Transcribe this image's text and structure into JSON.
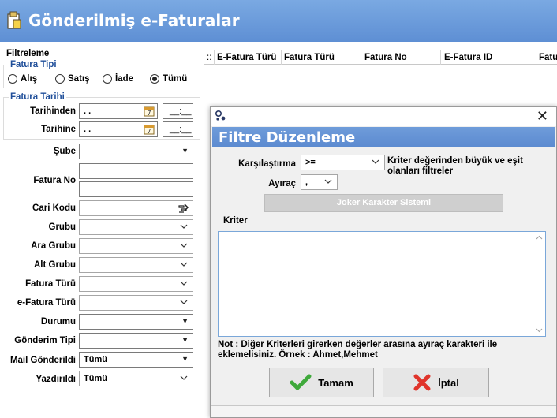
{
  "window": {
    "title": "Gönderilmiş e-Faturalar",
    "icon": "document-icon"
  },
  "filter": {
    "section_label": "Filtreleme",
    "fatura_tipi": {
      "label": "Fatura Tipi",
      "options": [
        {
          "label": "Alış",
          "selected": false
        },
        {
          "label": "Satış",
          "selected": false
        },
        {
          "label": "İade",
          "selected": false
        },
        {
          "label": "Tümü",
          "selected": true
        }
      ]
    },
    "fatura_tarihi": {
      "label": "Fatura Tarihi",
      "from_label": "Tarihinden",
      "to_label": "Tarihine",
      "date_value": ". .",
      "time_value": "__:__",
      "calendar_glyph": "7"
    },
    "fields": [
      {
        "label": "Şube",
        "value": "",
        "control": "combo"
      },
      {
        "label": "Fatura No",
        "value": "",
        "control": "double-text"
      },
      {
        "label": "Cari Kodu",
        "value": "",
        "control": "lookup"
      },
      {
        "label": "Grubu",
        "value": "",
        "control": "dropdown"
      },
      {
        "label": "Ara Grubu",
        "value": "",
        "control": "dropdown"
      },
      {
        "label": "Alt Grubu",
        "value": "",
        "control": "dropdown"
      },
      {
        "label": "Fatura Türü",
        "value": "",
        "control": "dropdown"
      },
      {
        "label": "e-Fatura Türü",
        "value": "",
        "control": "dropdown"
      },
      {
        "label": "Durumu",
        "value": "",
        "control": "combo"
      },
      {
        "label": "Gönderim Tipi",
        "value": "",
        "control": "combo"
      },
      {
        "label": "Mail Gönderildi",
        "value": "Tümü",
        "control": "combo"
      },
      {
        "label": "Yazdırıldı",
        "value": "Tümü",
        "control": "dropdown"
      }
    ]
  },
  "grid": {
    "handle": "::",
    "columns": [
      "E-Fatura Türü",
      "Fatura Türü",
      "Fatura No",
      "E-Fatura ID",
      "Fatu"
    ]
  },
  "dialog": {
    "title": "Filtre Düzenleme",
    "close_glyph": "✕",
    "comparison_label": "Karşılaştırma",
    "comparison_value": ">=",
    "comparison_hint": "Kriter değerinden büyük ve eşit olanları filtreler",
    "separator_label": "Ayıraç",
    "separator_value": ",",
    "joker_button": "Joker Karakter Sistemi",
    "criteria_label": "Kriter",
    "criteria_value": "",
    "note": "Not : Diğer Kriterleri girerken değerler arasına ayıraç karakteri ile eklemelisiniz. Örnek : Ahmet,Mehmet",
    "ok_button": "Tamam",
    "cancel_button": "İptal"
  },
  "colors": {
    "title_bar": "#6a9ad9",
    "dialog_header": "#6493d5",
    "panel_label_blue": "#1f4e99",
    "ok_check": "#3fa93b",
    "cancel_x": "#e0342b"
  }
}
